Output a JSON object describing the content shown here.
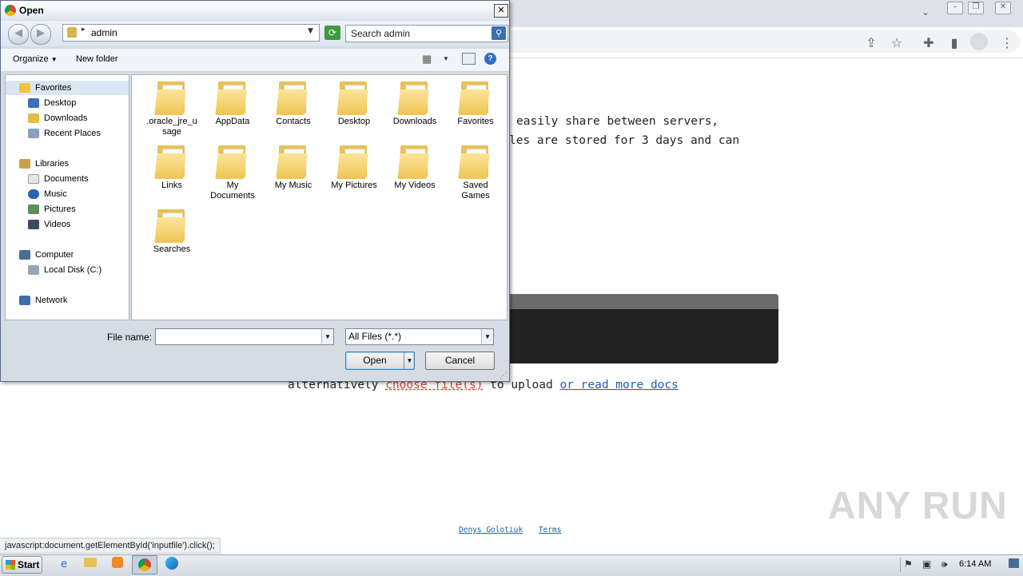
{
  "browser": {
    "icons": [
      "chevron-down-icon",
      "minimize-icon",
      "restore-icon",
      "close-icon",
      "share-icon",
      "star-icon",
      "extensions-icon",
      "sidepanel-icon",
      "profile-icon",
      "menu-icon"
    ]
  },
  "page": {
    "line1": "easily share between servers,",
    "line2": "les are stored for 3 days and can",
    "alt_prefix": "alternatively ",
    "choose_link": "choose file(s)",
    "alt_mid": " to upload ",
    "docs_link": "or read more docs",
    "footer_author": "Denys Golotiuk",
    "footer_terms": "Terms",
    "status_url": "javascript:document.getElementById('inputfile').click();",
    "watermark": "ANY RUN"
  },
  "dialog": {
    "title": "Open",
    "close": "✕",
    "address": "admin",
    "search_placeholder": "Search admin",
    "organize": "Organize",
    "new_folder": "New folder",
    "nav": {
      "favorites": "Favorites",
      "desktop": "Desktop",
      "downloads": "Downloads",
      "recent": "Recent Places",
      "libraries": "Libraries",
      "documents": "Documents",
      "music": "Music",
      "pictures": "Pictures",
      "videos": "Videos",
      "computer": "Computer",
      "local_disk": "Local Disk (C:)",
      "network": "Network"
    },
    "folders": [
      {
        "name": ".oracle_jre_u sage",
        "l1": ".oracle_jre_u",
        "l2": "sage",
        "icon": "folder-icon"
      },
      {
        "name": "AppData",
        "l1": "AppData",
        "l2": "",
        "icon": "folder-icon"
      },
      {
        "name": "Contacts",
        "l1": "Contacts",
        "l2": "",
        "icon": "contacts-folder-icon"
      },
      {
        "name": "Desktop",
        "l1": "Desktop",
        "l2": "",
        "icon": "desktop-folder-icon"
      },
      {
        "name": "Downloads",
        "l1": "Downloads",
        "l2": "",
        "icon": "downloads-folder-icon"
      },
      {
        "name": "Favorites",
        "l1": "Favorites",
        "l2": "",
        "icon": "favorites-folder-icon"
      },
      {
        "name": "Links",
        "l1": "Links",
        "l2": "",
        "icon": "links-folder-icon"
      },
      {
        "name": "My Documents",
        "l1": "My",
        "l2": "Documents",
        "icon": "documents-folder-icon"
      },
      {
        "name": "My Music",
        "l1": "My Music",
        "l2": "",
        "icon": "music-folder-icon"
      },
      {
        "name": "My Pictures",
        "l1": "My Pictures",
        "l2": "",
        "icon": "pictures-folder-icon"
      },
      {
        "name": "My Videos",
        "l1": "My Videos",
        "l2": "",
        "icon": "videos-folder-icon"
      },
      {
        "name": "Saved Games",
        "l1": "Saved",
        "l2": "Games",
        "icon": "games-folder-icon"
      },
      {
        "name": "Searches",
        "l1": "Searches",
        "l2": "",
        "icon": "searches-folder-icon"
      }
    ],
    "file_name_label": "File name:",
    "file_name_value": "",
    "file_type": "All Files (*.*)",
    "open": "Open",
    "cancel": "Cancel"
  },
  "taskbar": {
    "start": "Start",
    "clock": "6:14 AM"
  }
}
